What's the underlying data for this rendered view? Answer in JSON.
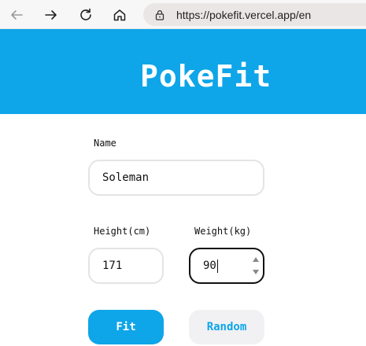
{
  "browser": {
    "url": "https://pokefit.vercel.app/en",
    "icons": [
      "back-icon",
      "forward-icon",
      "reload-icon",
      "home-icon",
      "lock-icon"
    ]
  },
  "app": {
    "title": "PokeFit",
    "accent_color": "#0ea5e9"
  },
  "form": {
    "name_label": "Name",
    "name_value": "Soleman",
    "height_label": "Height(cm)",
    "height_value": "171",
    "weight_label": "Weight(kg)",
    "weight_value": "90",
    "fit_label": "Fit",
    "random_label": "Random"
  }
}
